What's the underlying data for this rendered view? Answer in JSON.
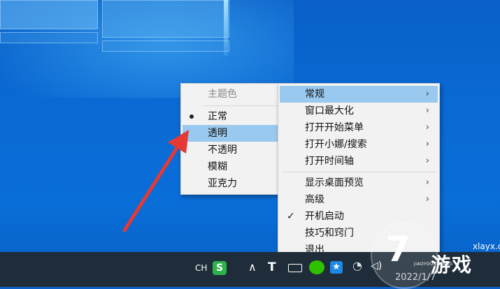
{
  "submenu": {
    "header": "主题色",
    "items": [
      {
        "label": "正常",
        "selected": true
      },
      {
        "label": "透明",
        "highlighted": true
      },
      {
        "label": "不透明"
      },
      {
        "label": "模糊"
      },
      {
        "label": "亚克力"
      }
    ]
  },
  "main_menu": {
    "groups": [
      [
        {
          "label": "常规",
          "submenu": true,
          "highlighted": true
        },
        {
          "label": "窗口最大化",
          "submenu": true
        },
        {
          "label": "打开开始菜单",
          "submenu": true
        },
        {
          "label": "打开小娜/搜索",
          "submenu": true
        },
        {
          "label": "打开时间轴",
          "submenu": true
        }
      ],
      [
        {
          "label": "显示桌面预览",
          "submenu": true
        },
        {
          "label": "高级",
          "submenu": true
        },
        {
          "label": "开机启动",
          "checked": true
        },
        {
          "label": "技巧和窍门"
        },
        {
          "label": "退出"
        }
      ]
    ],
    "arrow_glyph": "›",
    "check_glyph": "✓"
  },
  "taskbar": {
    "ime": "CH",
    "sogou": "S",
    "overflow": "∧",
    "date": "2022/1/7"
  },
  "watermark": {
    "site": "xlayx.com",
    "name": "游戏",
    "sub": "JIAOYOUXIWANG",
    "digit": "7"
  },
  "colors": {
    "highlight": "#99c9ef",
    "annotation_arrow": "#e53935",
    "menu_bg": "#f2f2f2"
  }
}
